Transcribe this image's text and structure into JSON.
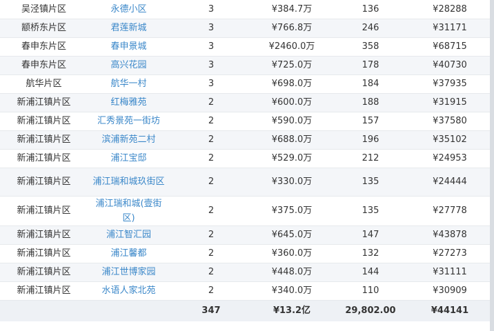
{
  "table": {
    "rows": [
      [
        "吴泾镇片区",
        "永德小区",
        "3",
        "¥384.7万",
        "136",
        "¥28288"
      ],
      [
        "颛桥东片区",
        "君莲新城",
        "3",
        "¥766.8万",
        "246",
        "¥31171"
      ],
      [
        "春申东片区",
        "春申景城",
        "3",
        "¥2460.0万",
        "358",
        "¥68715"
      ],
      [
        "春申东片区",
        "高兴花园",
        "3",
        "¥725.0万",
        "178",
        "¥40730"
      ],
      [
        "航华片区",
        "航华一村",
        "3",
        "¥698.0万",
        "184",
        "¥37935"
      ],
      [
        "新浦江镇片区",
        "红梅雅苑",
        "2",
        "¥600.0万",
        "188",
        "¥31915"
      ],
      [
        "新浦江镇片区",
        "汇秀景苑一街坊",
        "2",
        "¥590.0万",
        "157",
        "¥37580"
      ],
      [
        "新浦江镇片区",
        "滨浦新苑二村",
        "2",
        "¥688.0万",
        "196",
        "¥35102"
      ],
      [
        "新浦江镇片区",
        "浦江宝邸",
        "2",
        "¥529.0万",
        "212",
        "¥24953"
      ],
      [
        "新浦江镇片区",
        "浦江瑞和城玖街区",
        "2",
        "¥330.0万",
        "135",
        "¥24444"
      ],
      [
        "新浦江镇片区",
        "浦江瑞和城(壹街区)",
        "2",
        "¥375.0万",
        "135",
        "¥27778"
      ],
      [
        "新浦江镇片区",
        "浦江智汇园",
        "2",
        "¥645.0万",
        "147",
        "¥43878"
      ],
      [
        "新浦江镇片区",
        "浦江馨都",
        "2",
        "¥360.0万",
        "132",
        "¥27273"
      ],
      [
        "新浦江镇片区",
        "浦江世博家园",
        "2",
        "¥448.0万",
        "144",
        "¥31111"
      ],
      [
        "新浦江镇片区",
        "水语人家北苑",
        "2",
        "¥340.0万",
        "110",
        "¥30909"
      ]
    ],
    "total": [
      "",
      "",
      "347",
      "¥13.2亿",
      "29,802.00",
      "¥44141"
    ]
  }
}
